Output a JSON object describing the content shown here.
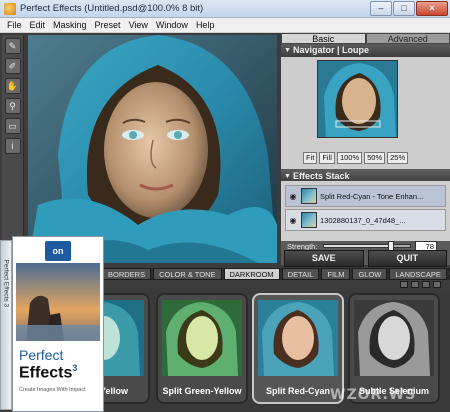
{
  "window": {
    "title": "Perfect Effects (Untitled.psd@100.0% 8 bit)",
    "minimize_icon": "minimize-icon",
    "maximize_icon": "maximize-icon",
    "close_icon": "close-icon"
  },
  "menu": [
    "File",
    "Edit",
    "Masking",
    "Preset",
    "View",
    "Window",
    "Help"
  ],
  "tools": [
    "brush-icon",
    "pencil-icon",
    "hand-icon",
    "zoom-icon",
    "compare-icon",
    "info-icon"
  ],
  "panel": {
    "tabs": [
      "Basic",
      "Advanced"
    ],
    "active_tab": "Basic",
    "navigator": {
      "title": "Navigator | Loupe",
      "zoom_buttons": [
        "Fit",
        "Fill",
        "100%",
        "50%",
        "25%"
      ]
    },
    "effects_stack": {
      "title": "Effects Stack",
      "layers": [
        {
          "label": "Split Red-Cyan - Tone Enhan...",
          "selected": true
        },
        {
          "label": "1302880137_0_47d48_...",
          "selected": false
        }
      ]
    },
    "strength": {
      "label": "Strength:",
      "value": "78",
      "fraction": 0.78
    }
  },
  "actions": {
    "save": "SAVE",
    "quit": "QUIT"
  },
  "categories": [
    "BORDERS",
    "COLOR & TONE",
    "DARKROOM",
    "DETAIL",
    "FILM",
    "GLOW",
    "LANDSCAPE"
  ],
  "active_category": "DARKROOM",
  "presets": [
    {
      "label": "Yellow",
      "tint": "#3a9aa8"
    },
    {
      "label": "Split Green-Yellow",
      "tint": "#5fb070"
    },
    {
      "label": "Split Red-Cyan",
      "tint": "#4aa3b8",
      "selected": true
    },
    {
      "label": "Subtle Selenium",
      "tint": "#9a9a9a"
    }
  ],
  "product_box": {
    "logo": "on",
    "spine": "Perfect Effects 3",
    "title_line1": "Perfect",
    "title_line2": "Effects",
    "version": "3",
    "tagline": "Create Images With Impact"
  },
  "watermark": "WZOR.WS"
}
